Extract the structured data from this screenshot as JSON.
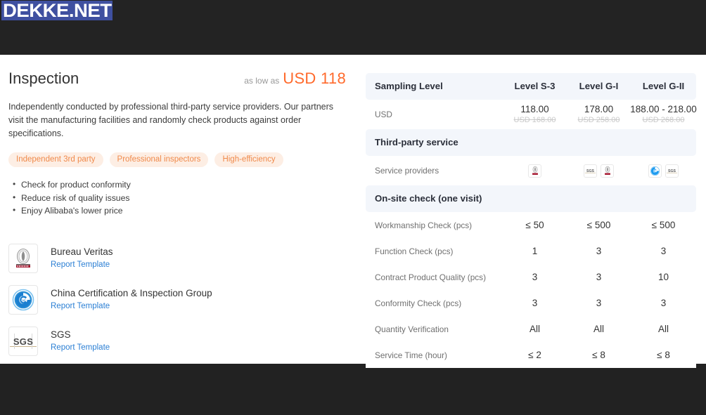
{
  "brand": {
    "logo_text": "DEKKE.NET",
    "logo_bg": "#3f50a0"
  },
  "service": {
    "title": "Inspection",
    "as_low_as_label": "as low as",
    "as_low_as_price": "USD 118",
    "accent_color": "#ff6a2c",
    "description": "Independently conducted by professional third-party service providers. Our partners visit the manufacturing facilities and randomly check products against order specifications.",
    "tags": [
      "Independent 3rd party",
      "Professional inspectors",
      "High-efficiency"
    ],
    "benefits": [
      "Check for product conformity",
      "Reduce risk of quality issues",
      "Enjoy Alibaba's lower price"
    ]
  },
  "providers": [
    {
      "name": "Bureau Veritas",
      "link_label": "Report Template",
      "logo": "bureau-veritas-logo"
    },
    {
      "name": "China Certification & Inspection Group",
      "link_label": "Report Template",
      "logo": "ccic-logo"
    },
    {
      "name": "SGS",
      "link_label": "Report Template",
      "logo": "sgs-logo"
    }
  ],
  "table": {
    "header": {
      "label": "Sampling Level",
      "columns": [
        "Level S-3",
        "Level G-I",
        "Level G-II"
      ]
    },
    "price_row": {
      "label": "USD",
      "values": [
        {
          "current": "118.00",
          "original": "USD 168.00"
        },
        {
          "current": "178.00",
          "original": "USD 258.00"
        },
        {
          "current": "188.00 - 218.00",
          "original": "USD 268.00"
        }
      ]
    },
    "sections": [
      {
        "title": "Third-party service",
        "rows": [
          {
            "label": "Service providers",
            "type": "logos",
            "values": [
              [
                "bureau-veritas-logo"
              ],
              [
                "sgs-logo",
                "bureau-veritas-logo"
              ],
              [
                "ccic-logo",
                "sgs-logo"
              ]
            ]
          }
        ]
      },
      {
        "title": "On-site check (one visit)",
        "rows": [
          {
            "label": "Workmanship Check (pcs)",
            "type": "text",
            "values": [
              "≤ 50",
              "≤ 500",
              "≤ 500"
            ]
          },
          {
            "label": "Function Check (pcs)",
            "type": "text",
            "values": [
              "1",
              "3",
              "3"
            ]
          },
          {
            "label": "Contract Product Quality (pcs)",
            "type": "text",
            "values": [
              "3",
              "3",
              "10"
            ]
          },
          {
            "label": "Conformity Check (pcs)",
            "type": "text",
            "values": [
              "3",
              "3",
              "3"
            ]
          },
          {
            "label": "Quantity Verification",
            "type": "text",
            "values": [
              "All",
              "All",
              "All"
            ]
          },
          {
            "label": "Service Time (hour)",
            "type": "text",
            "values": [
              "≤ 2",
              "≤ 8",
              "≤ 8"
            ]
          }
        ]
      }
    ]
  }
}
